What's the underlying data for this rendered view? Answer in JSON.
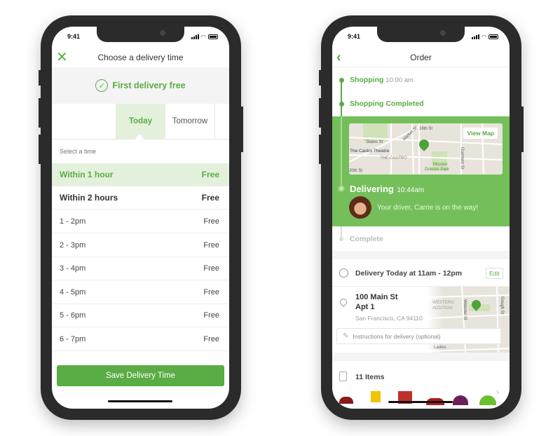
{
  "left_phone": {
    "status_time": "9:41",
    "header": {
      "title": "Choose a delivery time",
      "close_icon": "close-x-icon"
    },
    "banner": {
      "icon": "check-circle-icon",
      "text": "First delivery free"
    },
    "tabs": [
      {
        "label": "Today",
        "selected": true
      },
      {
        "label": "Tomorrow",
        "selected": false
      }
    ],
    "section_label": "Select a time",
    "time_options": [
      {
        "label": "Within 1 hour",
        "price": "Free",
        "selected": true
      },
      {
        "label": "Within 2 hours",
        "price": "Free"
      },
      {
        "label": "1 - 2pm",
        "price": "Free"
      },
      {
        "label": "2 - 3pm",
        "price": "Free"
      },
      {
        "label": "3 - 4pm",
        "price": "Free"
      },
      {
        "label": "4 - 5pm",
        "price": "Free"
      },
      {
        "label": "5 - 6pm",
        "price": "Free"
      },
      {
        "label": "6 - 7pm",
        "price": "Free"
      }
    ],
    "save_button": "Save Delivery Time",
    "accent_color": "#5aac44"
  },
  "right_phone": {
    "status_time": "9:41",
    "header": {
      "title": "Order",
      "back_icon": "chevron-left-icon"
    },
    "timeline": {
      "shopping": {
        "label": "Shopping",
        "time": "10:00 am"
      },
      "shopping_completed": {
        "label": "Shopping Completed"
      },
      "delivering": {
        "label": "Delivering",
        "time": "10:44am",
        "message": "Your driver, Carrie is on the way!"
      },
      "complete": {
        "label": "Complete"
      }
    },
    "map": {
      "view_map": "View Map",
      "labels": [
        "Market St",
        "16th St",
        "States St",
        "The Castro Theatre",
        "THE CASTRO",
        "Mission",
        "Dolores Park",
        "Guerrero St",
        "20th St"
      ]
    },
    "delivery": {
      "icon": "clock-icon",
      "text": "Delivery Today at 11am - 12pm",
      "edit": "Edit"
    },
    "address": {
      "icon": "location-pin-icon",
      "line1": "100 Main St",
      "line2": "Apt 1",
      "city": "San Francisco, CA 94110"
    },
    "address_map_labels": [
      "WESTERN",
      "ADDITION",
      "Webster St",
      "Gough St",
      "Ladies"
    ],
    "instructions": {
      "icon": "edit-icon",
      "placeholder": "Instructions for delivery (optional)"
    },
    "items": {
      "icon": "bag-icon",
      "count_label": "11 Items",
      "thumbnail_colors": [
        "#8b1a1a",
        "#f2c400",
        "#c0302a",
        "#b01c1c",
        "#6a1f5a",
        "#6cbf2f"
      ]
    },
    "delivering_bg": "#74bf5a"
  }
}
